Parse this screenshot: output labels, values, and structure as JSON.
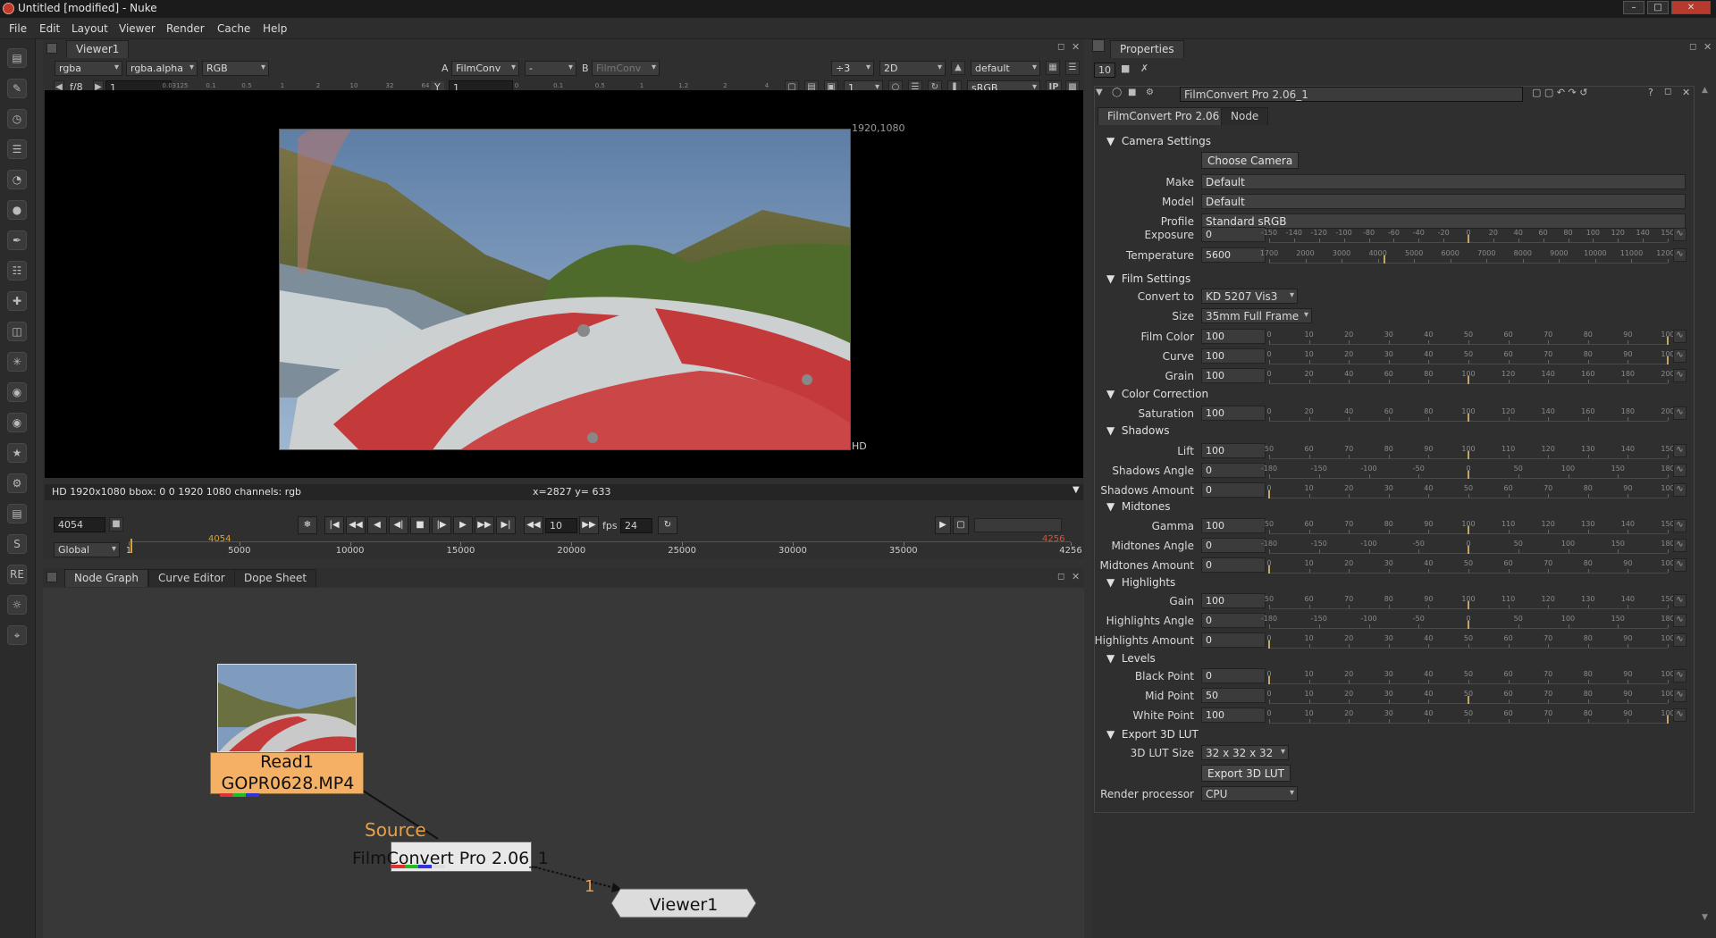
{
  "window": {
    "title": "Untitled [modified] - Nuke"
  },
  "menu": [
    "File",
    "Edit",
    "Layout",
    "Viewer",
    "Render",
    "Cache",
    "Help"
  ],
  "left_tools": [
    "image-tool-icon",
    "draw-tool-icon",
    "time-tool-icon",
    "channel-tool-icon",
    "color-tool-icon",
    "filter-tool-icon",
    "keyer-tool-icon",
    "merge-tool-icon",
    "transform-tool-icon",
    "3d-tool-icon",
    "particles-tool-icon",
    "deep-tool-icon",
    "views-tool-icon",
    "metadata-tool-icon",
    "toolsets-tool-icon",
    "other-tool-icon",
    "plugin-s-tool-icon",
    "plugin-re-tool-icon",
    "plugin-globe-tool-icon",
    "plugin-fc-tool-icon"
  ],
  "viewer": {
    "tab": "Viewer1",
    "row1": {
      "channels": "rgba",
      "alpha": "rgba.alpha",
      "display": "RGB",
      "a_label": "A",
      "a_input": "FilmConv",
      "a_op": "-",
      "b_label": "B",
      "b_input": "FilmConv",
      "downrez": "÷3",
      "view_mode": "2D",
      "lut": "default"
    },
    "row2": {
      "fstop": "f/8",
      "gain": "1",
      "y_label": "Y",
      "gamma": "1",
      "frame": "1",
      "colorspace": "sRGB",
      "ip": "IP",
      "gain_ticks": [
        "0.03125",
        "0.1",
        "0.5",
        "1",
        "2",
        "10",
        "32",
        "64"
      ],
      "gamma_ticks": [
        "0",
        "0.1",
        "0.5",
        "1",
        "1.2",
        "2",
        "4"
      ]
    },
    "format_label": "1920,1080",
    "format_name": "HD",
    "info": "HD 1920x1080 bbox: 0 0 1920 1080 channels: rgb",
    "coords": "x=2827 y= 633"
  },
  "transport": {
    "frame": "4054",
    "step": "10",
    "fps_label": "fps",
    "fps": "24",
    "range_mode": "Global",
    "current_marker": "4054",
    "end_marker": "4256",
    "ruler": [
      {
        "label": "1",
        "value": 1
      },
      {
        "label": "5000",
        "value": 5000
      },
      {
        "label": "10000",
        "value": 10000
      },
      {
        "label": "15000",
        "value": 15000
      },
      {
        "label": "20000",
        "value": 20000
      },
      {
        "label": "25000",
        "value": 25000
      },
      {
        "label": "30000",
        "value": 30000
      },
      {
        "label": "35000",
        "value": 35000
      },
      {
        "label": "4256",
        "value": 42560
      }
    ]
  },
  "nodegraph": {
    "tabs": [
      "Node Graph",
      "Curve Editor",
      "Dope Sheet"
    ],
    "read_node": {
      "name": "Read1",
      "file": "GOPR0628.MP4"
    },
    "source_label": "Source",
    "fc_node": "FilmConvert Pro 2.06_1",
    "pipe_label": "1",
    "viewer_node": "Viewer1"
  },
  "properties": {
    "tab": "Properties",
    "max_panels": "10",
    "node_name": "FilmConvert Pro 2.06_1",
    "tabs": [
      "FilmConvert Pro 2.06",
      "Node"
    ],
    "camera_settings": "Camera Settings",
    "choose_camera": "Choose Camera",
    "make_label": "Make",
    "make": "Default",
    "model_label": "Model",
    "model": "Default",
    "profile_label": "Profile",
    "profile": "Standard sRGB",
    "film_settings": "Film Settings",
    "convert_label": "Convert to",
    "convert": "KD 5207 Vis3",
    "size_label": "Size",
    "size": "35mm Full Frame",
    "color_correction": "Color Correction",
    "shadows": "Shadows",
    "midtones": "Midtones",
    "highlights": "Highlights",
    "levels": "Levels",
    "export_section": "Export 3D LUT",
    "lut_size_label": "3D LUT Size",
    "lut_size": "32 x 32 x 32",
    "export_button": "Export 3D LUT",
    "render_label": "Render processor",
    "render": "CPU",
    "sliders": [
      {
        "label": "Exposure",
        "value": "0",
        "level": 0.5,
        "ticks": [
          "-150",
          "-140",
          "-120",
          "-100",
          "-80",
          "-60",
          "-40",
          "-20",
          "0",
          "20",
          "40",
          "60",
          "80",
          "100",
          "120",
          "140",
          "150"
        ]
      },
      {
        "label": "Temperature",
        "value": "5600",
        "level": 0.29,
        "ticks": [
          "1700",
          "2000",
          "3000",
          "4000",
          "5000",
          "6000",
          "7000",
          "8000",
          "9000",
          "10000",
          "11000",
          "12000"
        ]
      },
      {
        "label": "Film Color",
        "value": "100",
        "level": 1.0,
        "ticks": [
          "0",
          "10",
          "20",
          "30",
          "40",
          "50",
          "60",
          "70",
          "80",
          "90",
          "100"
        ]
      },
      {
        "label": "Curve",
        "value": "100",
        "level": 1.0,
        "ticks": [
          "0",
          "10",
          "20",
          "30",
          "40",
          "50",
          "60",
          "70",
          "80",
          "90",
          "100"
        ]
      },
      {
        "label": "Grain",
        "value": "100",
        "level": 0.5,
        "ticks": [
          "0",
          "20",
          "40",
          "60",
          "80",
          "100",
          "120",
          "140",
          "160",
          "180",
          "200"
        ]
      },
      {
        "label": "Saturation",
        "value": "100",
        "level": 0.5,
        "ticks": [
          "0",
          "20",
          "40",
          "60",
          "80",
          "100",
          "120",
          "140",
          "160",
          "180",
          "200"
        ]
      },
      {
        "label": "Lift",
        "value": "100",
        "level": 0.5,
        "ticks": [
          "50",
          "60",
          "70",
          "80",
          "90",
          "100",
          "110",
          "120",
          "130",
          "140",
          "150"
        ]
      },
      {
        "label": "Shadows Angle",
        "value": "0",
        "level": 0.5,
        "ticks": [
          "-180",
          "-150",
          "-100",
          "-50",
          "0",
          "50",
          "100",
          "150",
          "180"
        ]
      },
      {
        "label": "Shadows Amount",
        "value": "0",
        "level": 0.0,
        "ticks": [
          "0",
          "10",
          "20",
          "30",
          "40",
          "50",
          "60",
          "70",
          "80",
          "90",
          "100"
        ]
      },
      {
        "label": "Gamma",
        "value": "100",
        "level": 0.5,
        "ticks": [
          "50",
          "60",
          "70",
          "80",
          "90",
          "100",
          "110",
          "120",
          "130",
          "140",
          "150"
        ]
      },
      {
        "label": "Midtones Angle",
        "value": "0",
        "level": 0.5,
        "ticks": [
          "-180",
          "-150",
          "-100",
          "-50",
          "0",
          "50",
          "100",
          "150",
          "180"
        ]
      },
      {
        "label": "Midtones Amount",
        "value": "0",
        "level": 0.0,
        "ticks": [
          "0",
          "10",
          "20",
          "30",
          "40",
          "50",
          "60",
          "70",
          "80",
          "90",
          "100"
        ]
      },
      {
        "label": "Gain",
        "value": "100",
        "level": 0.5,
        "ticks": [
          "50",
          "60",
          "70",
          "80",
          "90",
          "100",
          "110",
          "120",
          "130",
          "140",
          "150"
        ]
      },
      {
        "label": "Highlights Angle",
        "value": "0",
        "level": 0.5,
        "ticks": [
          "-180",
          "-150",
          "-100",
          "-50",
          "0",
          "50",
          "100",
          "150",
          "180"
        ]
      },
      {
        "label": "Highlights Amount",
        "value": "0",
        "level": 0.0,
        "ticks": [
          "0",
          "10",
          "20",
          "30",
          "40",
          "50",
          "60",
          "70",
          "80",
          "90",
          "100"
        ]
      },
      {
        "label": "Black Point",
        "value": "0",
        "level": 0.0,
        "ticks": [
          "0",
          "10",
          "20",
          "30",
          "40",
          "50",
          "60",
          "70",
          "80",
          "90",
          "100"
        ]
      },
      {
        "label": "Mid Point",
        "value": "50",
        "level": 0.5,
        "ticks": [
          "0",
          "10",
          "20",
          "30",
          "40",
          "50",
          "60",
          "70",
          "80",
          "90",
          "100"
        ]
      },
      {
        "label": "White Point",
        "value": "100",
        "level": 1.0,
        "ticks": [
          "0",
          "10",
          "20",
          "30",
          "40",
          "50",
          "60",
          "70",
          "80",
          "90",
          "100"
        ]
      }
    ]
  }
}
